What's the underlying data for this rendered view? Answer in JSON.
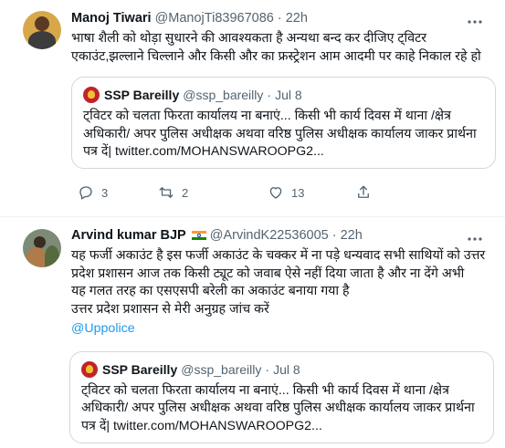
{
  "tweets": [
    {
      "name": "Manoj Tiwari",
      "handle": "@ManojTi83967086",
      "dot": "·",
      "time": "22h",
      "text": "भाषा शैली को थोड़ा सुधारने की आवश्यकता है अन्यथा बन्द कर दीजिए ट्विटर एकाउंट,झल्लाने चिल्लाने और किसी और का फ्रस्ट्रेशन आम आदमी पर काहे निकाल रहे हो",
      "quote": {
        "name": "SSP Bareilly",
        "handle": "@ssp_bareilly",
        "dot": "·",
        "time": "Jul 8",
        "text": "ट्विटर को चलता फिरता कार्यालय ना बनाएं... किसी भी कार्य दिवस में थाना /क्षेत्र अधिकारी/ अपर पुलिस अधीक्षक अथवा वरिष्ठ पुलिस अधीक्षक कार्यालय जाकर प्रार्थना पत्र दें| twitter.com/MOHANSWAROOPG2..."
      },
      "counts": {
        "reply": "3",
        "retweet": "2",
        "like": "13"
      }
    },
    {
      "name": "Arvind kumar BJP",
      "handle": "@ArvindK22536005",
      "dot": "·",
      "time": "22h",
      "text": "यह फर्जी अकाउंट है इस फर्जी अकाउंट के चक्कर में ना पड़े धन्यवाद सभी साथियों को उत्तर प्रदेश प्रशासन आज तक किसी ट्यूट को जवाब ऐसे नहीं दिया जाता है और ना देंगे अभी\nयह गलत तरह का एसएसपी बरेली का अकाउंट बनाया गया है\nउत्तर प्रदेश प्रशासन से मेरी अनुग्रह जांच करें",
      "mention": "@Uppolice",
      "quote": {
        "name": "SSP Bareilly",
        "handle": "@ssp_bareilly",
        "dot": "·",
        "time": "Jul 8",
        "text": "ट्विटर को चलता फिरता कार्यालय ना बनाएं... किसी भी कार्य दिवस में थाना /क्षेत्र अधिकारी/ अपर पुलिस अधीक्षक अथवा वरिष्ठ पुलिस अधीक्षक कार्यालय जाकर प्रार्थना पत्र दें| twitter.com/MOHANSWAROOPG2..."
      }
    }
  ],
  "icons": {
    "more": "more-dots-icon",
    "reply": "reply-icon",
    "retweet": "retweet-icon",
    "like": "heart-icon",
    "share": "share-icon",
    "flag": "india-flag-icon"
  },
  "colors": {
    "link": "#1d9bf0",
    "secondary": "#536471",
    "border": "#cfd9de",
    "flag_saffron": "#ff9933",
    "flag_green": "#138808"
  }
}
